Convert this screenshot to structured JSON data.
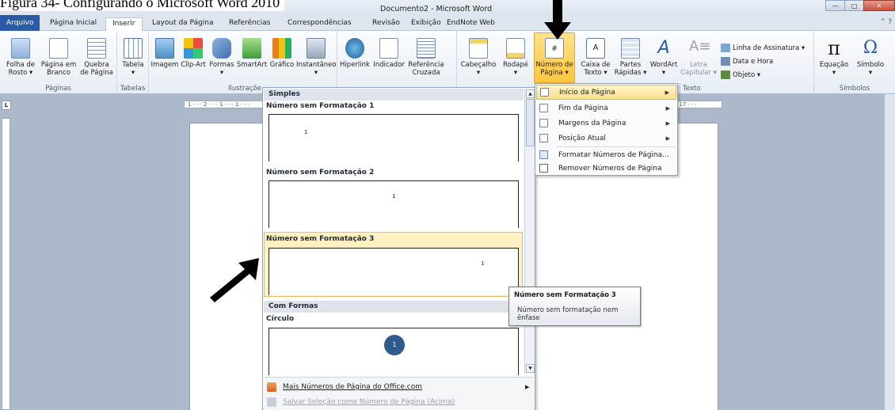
{
  "caption": "Figura 34- Configurando o Microsoft Word 2010",
  "window": {
    "title": "Documento2 - Microsoft Word",
    "quick_access": "▾ ↶ ↷ | ▾",
    "minimize": "—",
    "maximize": "□",
    "close": "✕"
  },
  "tabs": {
    "file": "Arquivo",
    "items": [
      "Página Inicial",
      "Inserir",
      "Layout da Página",
      "Referências",
      "Correspondências",
      "Revisão",
      "Exibição",
      "EndNote Web"
    ],
    "help": "⌃ ?"
  },
  "ribbon": {
    "groups": {
      "paginas": "Páginas",
      "tabelas": "Tabelas",
      "ilustracoes": "Ilustraçõe",
      "texto": "Texto",
      "simbolos": "Símbolos"
    },
    "buttons": {
      "folha_rosto": "Folha de\nRosto ▾",
      "pagina_branco": "Página em\nBranco",
      "quebra_pagina": "Quebra\nde Página",
      "tabela": "Tabela\n▾",
      "imagem": "Imagem",
      "clipart": "Clip-Art",
      "formas": "Formas\n▾",
      "smartart": "SmartArt",
      "grafico": "Gráfico",
      "instantaneo": "Instantâneo\n▾",
      "hiperlink": "Hiperlink",
      "indicador": "Indicador",
      "referencia_cruzada": "Referência\nCruzada",
      "cabecalho": "Cabeçalho\n▾",
      "rodape": "Rodapé\n▾",
      "numero_pagina": "Número de\nPágina ▾",
      "caixa_texto": "Caixa de\nTexto ▾",
      "partes_rapidas": "Partes\nRápidas ▾",
      "wordart": "WordArt\n▾",
      "letra_capitular": "Letra\nCapitular ▾",
      "equacao": "Equação\n▾",
      "simbolo": "Símbolo\n▾"
    },
    "small": {
      "linha_assinatura": "Linha de Assinatura ▾",
      "data_hora": "Data e Hora",
      "objeto": "Objeto ▾"
    }
  },
  "ruler": {
    "top": "1 · · · 2 · · · 1 · · · 1 · · ·",
    "top_right": "· 17 · · ·",
    "corner": "L"
  },
  "gallery": {
    "section1": "Simples",
    "items": [
      {
        "label": "Número sem Formatação 1",
        "num": "1"
      },
      {
        "label": "Número sem Formatação 2",
        "num": "1"
      },
      {
        "label": "Número sem Formatação 3",
        "num": "1"
      }
    ],
    "section2": "Com Formas",
    "circle": {
      "label": "Círculo",
      "num": "1"
    },
    "footer": {
      "more": "Mais Números de Página do Office.com",
      "save": "Salvar Seleção como Número de Página (Acima)"
    }
  },
  "menu": {
    "items": [
      {
        "label": "Início da Página",
        "sub": "▶"
      },
      {
        "label": "Fim da Página",
        "sub": "▶"
      },
      {
        "label": "Margens da Página",
        "sub": "▶"
      },
      {
        "label": "Posição Atual",
        "sub": "▶"
      },
      {
        "label": "Formatar Números de Página...",
        "sub": ""
      },
      {
        "label": "Remover Números de Página",
        "sub": ""
      }
    ]
  },
  "tooltip": {
    "title": "Número sem Formatação 3",
    "body": "Número sem formatação nem ênfase"
  },
  "colors": {
    "accent": "#2a5ba8",
    "highlight": "#fdc640",
    "workspace": "#abb9ca"
  }
}
